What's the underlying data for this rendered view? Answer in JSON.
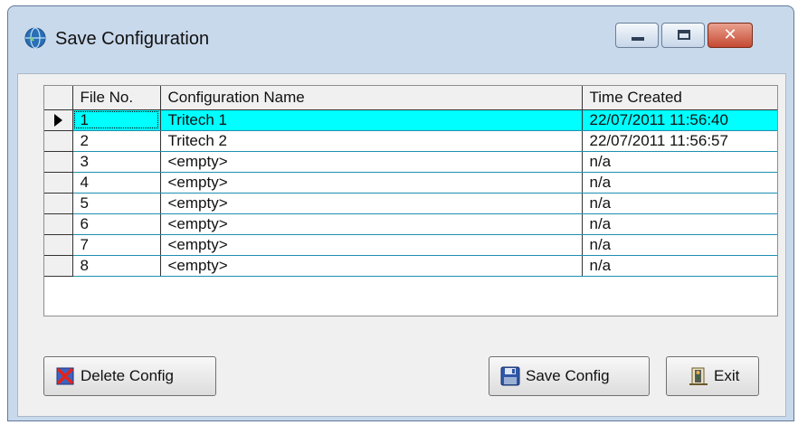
{
  "window": {
    "title": "Save Configuration",
    "controls": {
      "minimize": "minimize",
      "maximize": "maximize",
      "close": "✕"
    }
  },
  "grid": {
    "columns": [
      "File No.",
      "Configuration Name",
      "Time Created"
    ],
    "selected_row": 0,
    "rows": [
      {
        "no": "1",
        "name": "Tritech 1",
        "time": "22/07/2011 11:56:40"
      },
      {
        "no": "2",
        "name": "Tritech 2",
        "time": "22/07/2011 11:56:57"
      },
      {
        "no": "3",
        "name": "<empty>",
        "time": "n/a"
      },
      {
        "no": "4",
        "name": "<empty>",
        "time": "n/a"
      },
      {
        "no": "5",
        "name": "<empty>",
        "time": "n/a"
      },
      {
        "no": "6",
        "name": "<empty>",
        "time": "n/a"
      },
      {
        "no": "7",
        "name": "<empty>",
        "time": "n/a"
      },
      {
        "no": "8",
        "name": "<empty>",
        "time": "n/a"
      }
    ]
  },
  "buttons": {
    "delete": {
      "label": "Delete Config",
      "icon": "delete-x-icon"
    },
    "save": {
      "label": "Save Config",
      "icon": "floppy-disk-icon"
    },
    "exit": {
      "label": "Exit",
      "icon": "exit-door-icon"
    }
  },
  "colors": {
    "selected_row": "#00ffff",
    "row_divider": "#1e8fb0",
    "window_frame": "#c9d9ec"
  }
}
